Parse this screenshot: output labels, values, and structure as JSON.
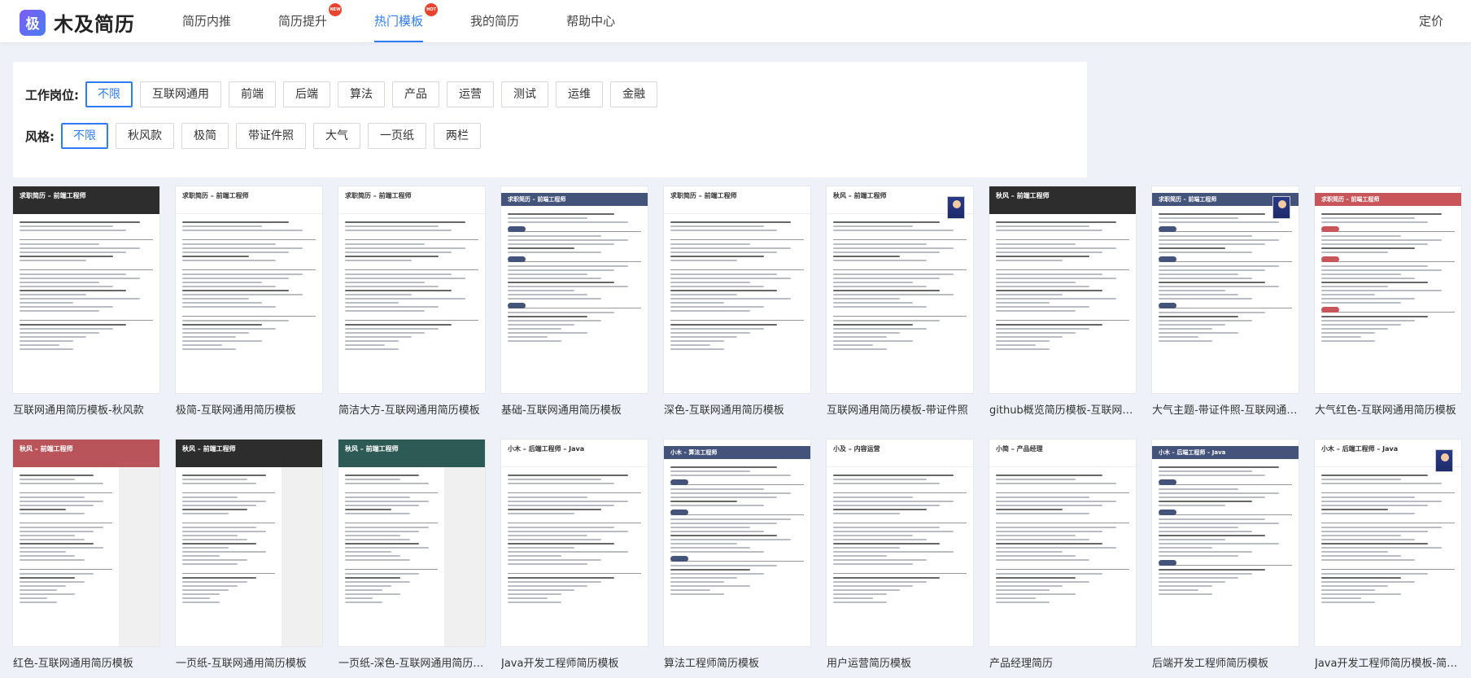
{
  "header": {
    "logo_glyph": "极",
    "brand": "木及简历",
    "nav": [
      {
        "label": "简历内推",
        "badge": "",
        "active": false
      },
      {
        "label": "简历提升",
        "badge": "NEW",
        "active": false
      },
      {
        "label": "热门模板",
        "badge": "HOT",
        "active": true
      },
      {
        "label": "我的简历",
        "badge": "",
        "active": false
      },
      {
        "label": "帮助中心",
        "badge": "",
        "active": false
      }
    ],
    "pricing": "定价"
  },
  "filters": {
    "position_label": "工作岗位:",
    "positions": [
      "不限",
      "互联网通用",
      "前端",
      "后端",
      "算法",
      "产品",
      "运营",
      "测试",
      "运维",
      "金融"
    ],
    "position_selected": "不限",
    "style_label": "风格:",
    "styles": [
      "不限",
      "秋风款",
      "极简",
      "带证件照",
      "大气",
      "一页纸",
      "两栏"
    ],
    "style_selected": "不限"
  },
  "templates": [
    {
      "title": "互联网通用简历模板-秋风款",
      "thumb_name": "求职简历 – 前端工程师",
      "theme": "dark",
      "photo": false,
      "side": false
    },
    {
      "title": "极简-互联网通用简历模板",
      "thumb_name": "求职简历 – 前端工程师",
      "theme": "none",
      "photo": false,
      "side": false
    },
    {
      "title": "简洁大方-互联网通用简历模板",
      "thumb_name": "求职简历 – 前端工程师",
      "theme": "none",
      "photo": false,
      "side": false
    },
    {
      "title": "基础-互联网通用简历模板",
      "thumb_name": "求职简历 – 前端工程师",
      "theme": "navy",
      "photo": false,
      "side": false
    },
    {
      "title": "深色-互联网通用简历模板",
      "thumb_name": "求职简历 – 前端工程师",
      "theme": "none",
      "photo": false,
      "side": false
    },
    {
      "title": "互联网通用简历模板-带证件照",
      "thumb_name": "秋风 – 前端工程师",
      "theme": "none",
      "photo": true,
      "side": false
    },
    {
      "title": "github概览简历模板-互联网通用简历模板",
      "thumb_name": "秋风 – 前端工程师",
      "theme": "dark",
      "photo": false,
      "side": false
    },
    {
      "title": "大气主题-带证件照-互联网通用简历模板",
      "thumb_name": "求职简历 – 前端工程师",
      "theme": "navy",
      "photo": true,
      "side": false
    },
    {
      "title": "大气红色-互联网通用简历模板",
      "thumb_name": "求职简历 – 前端工程师",
      "theme": "red",
      "photo": false,
      "side": false
    },
    {
      "title": "红色-互联网通用简历模板",
      "thumb_name": "秋风 – 前端工程师",
      "theme": "sidered",
      "photo": false,
      "side": true
    },
    {
      "title": "一页纸-互联网通用简历模板",
      "thumb_name": "秋风 – 前端工程师",
      "theme": "sidedark",
      "photo": false,
      "side": true
    },
    {
      "title": "一页纸-深色-互联网通用简历模板",
      "thumb_name": "秋风 – 前端工程师",
      "theme": "sideteal",
      "photo": false,
      "side": true
    },
    {
      "title": "Java开发工程师简历模板",
      "thumb_name": "小木 – 后端工程师 – Java",
      "theme": "none",
      "photo": false,
      "side": false
    },
    {
      "title": "算法工程师简历模板",
      "thumb_name": "小木 – 算法工程师",
      "theme": "navy",
      "photo": false,
      "side": false
    },
    {
      "title": "用户运营简历模板",
      "thumb_name": "小及 – 内容运营",
      "theme": "none",
      "photo": false,
      "side": false
    },
    {
      "title": "产品经理简历",
      "thumb_name": "小简 – 产品经理",
      "theme": "none",
      "photo": false,
      "side": false
    },
    {
      "title": "后端开发工程师简历模板",
      "thumb_name": "小木 – 后端工程师 – Java",
      "theme": "navy",
      "photo": false,
      "side": false
    },
    {
      "title": "Java开发工程师简历模板-简洁大方",
      "thumb_name": "小木 – 后端工程师 – Java",
      "theme": "none",
      "photo": true,
      "side": false
    }
  ],
  "colors": {
    "accent": "#2f7cf6",
    "badge": "#e8432f",
    "navy": "#44537a",
    "red": "#c8555a"
  }
}
